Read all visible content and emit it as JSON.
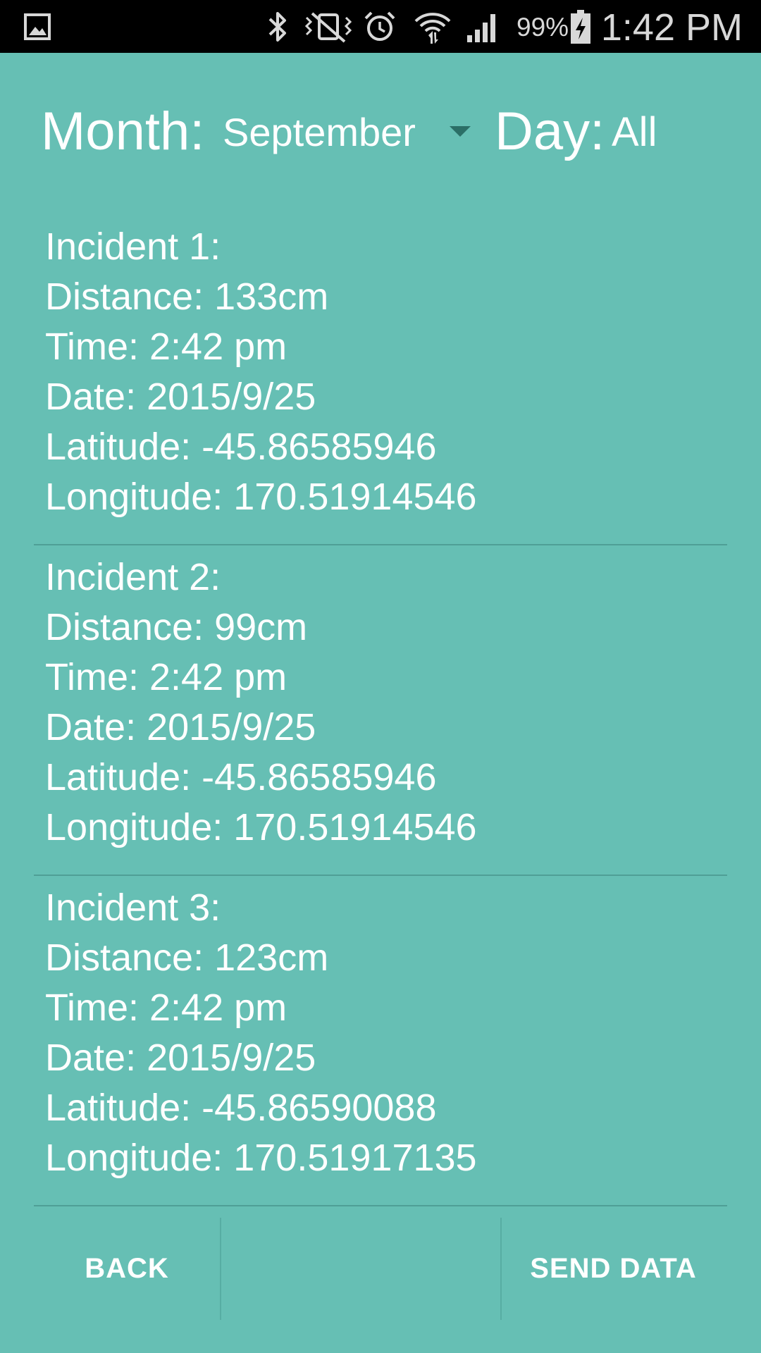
{
  "status_bar": {
    "battery_percent": "99%",
    "time": "1:42 PM",
    "icons": [
      "gallery-icon",
      "bluetooth-icon",
      "vibrate-mute-icon",
      "alarm-icon",
      "wifi-icon",
      "signal-icon",
      "battery-charging-icon"
    ]
  },
  "filter": {
    "month_label": "Month:",
    "month_value": "September",
    "day_label": "Day:",
    "day_value": "All"
  },
  "incidents": [
    {
      "title": "Incident 1:",
      "distance": "Distance: 133cm",
      "time": "Time: 2:42 pm",
      "date": "Date: 2015/9/25",
      "latitude": "Latitude: -45.86585946",
      "longitude": "Longitude: 170.51914546"
    },
    {
      "title": "Incident 2:",
      "distance": "Distance: 99cm",
      "time": "Time: 2:42 pm",
      "date": "Date: 2015/9/25",
      "latitude": "Latitude: -45.86585946",
      "longitude": "Longitude: 170.51914546"
    },
    {
      "title": "Incident 3:",
      "distance": "Distance: 123cm",
      "time": "Time: 2:42 pm",
      "date": "Date: 2015/9/25",
      "latitude": "Latitude: -45.86590088",
      "longitude": "Longitude: 170.51917135"
    }
  ],
  "buttons": {
    "back_label": "BACK",
    "send_label": "SEND DATA"
  },
  "colors": {
    "background": "#66bfb4",
    "status_bar": "#000000",
    "text": "#ffffff",
    "divider": "#4f9f96",
    "caret": "#2b6f67"
  }
}
